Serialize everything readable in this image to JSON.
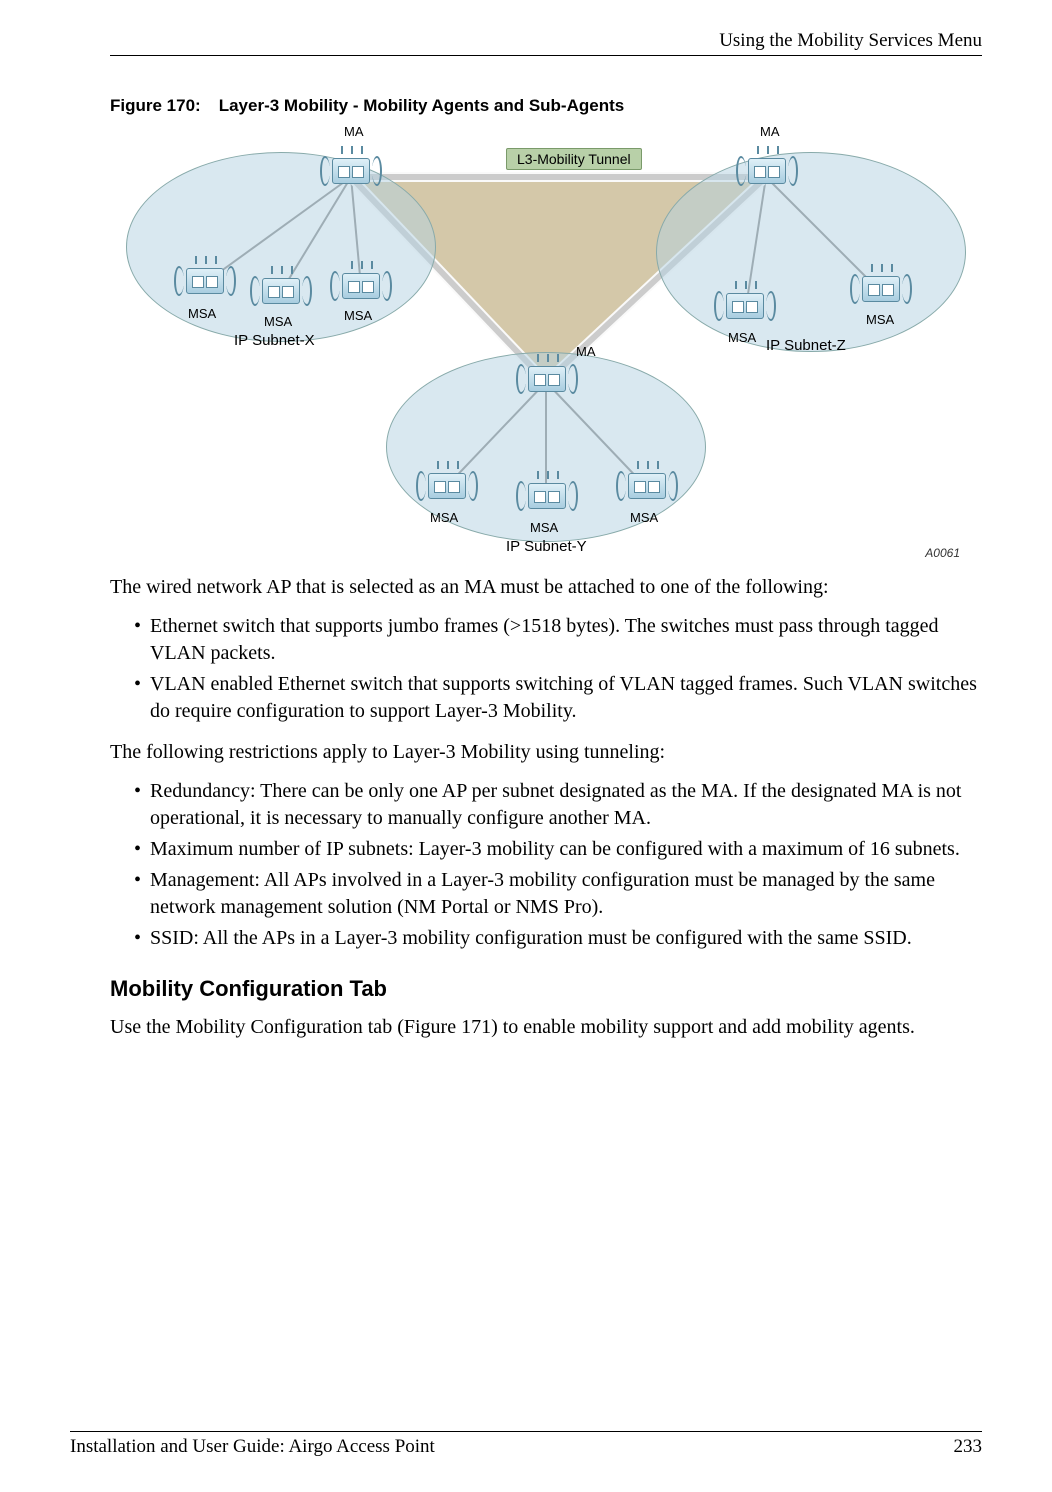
{
  "header": {
    "running": "Using the Mobility Services Menu"
  },
  "figure": {
    "caption_prefix": "Figure 170:",
    "caption_text": "Layer-3 Mobility - Mobility Agents and Sub-Agents",
    "labels": {
      "ma1": "MA",
      "ma2": "MA",
      "ma3": "MA",
      "msa1": "MSA",
      "msa2": "MSA",
      "msa3": "MSA",
      "msa4": "MSA",
      "msa5": "MSA",
      "msa6": "MSA",
      "msa7": "MSA",
      "msa8": "MSA",
      "subX": "IP Subnet-X",
      "subY": "IP Subnet-Y",
      "subZ": "IP Subnet-Z",
      "tunnel": "L3-Mobility Tunnel",
      "imgid": "A0061"
    }
  },
  "body": {
    "p1": "The wired network AP that is selected as an MA must be attached to one of the following:",
    "list1": [
      "Ethernet switch that supports jumbo frames (>1518 bytes). The switches must pass through tagged VLAN packets.",
      "VLAN enabled Ethernet switch that supports switching of VLAN tagged frames. Such VLAN switches do require configuration to support Layer-3 Mobility."
    ],
    "p2": "The following restrictions apply to Layer-3 Mobility using tunneling:",
    "list2": [
      "Redundancy: There can be only one AP per subnet designated as the MA. If the designated MA is not operational, it is necessary to manually configure another MA.",
      "Maximum number of IP subnets: Layer-3 mobility can be configured with a maximum of 16 subnets.",
      "Management: All APs involved in a Layer-3 mobility configuration must be managed by the same network management solution (NM Portal or NMS Pro).",
      "SSID: All the APs in a Layer-3 mobility configuration must be configured with the same SSID."
    ],
    "h2": "Mobility Configuration Tab",
    "p3": "Use the Mobility Configuration tab (Figure 171) to enable mobility support and add mobility agents."
  },
  "footer": {
    "left": "Installation and User Guide: Airgo Access Point",
    "right": "233"
  }
}
